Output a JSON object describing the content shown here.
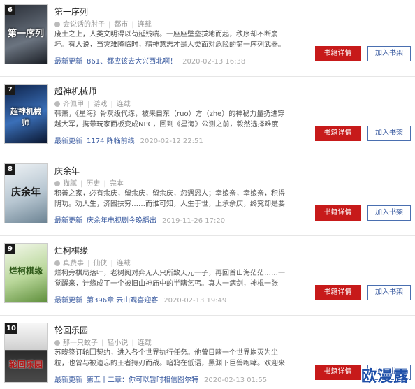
{
  "books": [
    {
      "rank": "6",
      "title": "第一序列",
      "author": "会说话的肘子",
      "category": "都市",
      "status": "连载",
      "desc": "废土之上，人类文明得以苟延残喘。一座座壁垒拔地而起，秩序却不断崩坏。有人说，当灾难降临时，精神意志才是人类面对危险的第一序列武器。有人说，不要让",
      "latest_label": "最新更新",
      "latest_chapter": "861、都应该去大兴西北啊！",
      "updated": "2020-02-13 16:38",
      "cover_text": "第一序列",
      "cover_colors": [
        "#2a2f38",
        "#6b7480"
      ]
    },
    {
      "rank": "7",
      "title": "超神机械师",
      "author": "齐佩甲",
      "category": "游戏",
      "status": "连载",
      "desc": "韩萧，《星海》骨灰级代练，被来自东（ruo）方（zhe）的神秘力量扔进穿越大军，携带玩家面板变成NPC，回到《星海》公测之前，毅然选择难度最高的机械系。战",
      "latest_label": "最新更新",
      "latest_chapter": "1174 降临前线",
      "updated": "2020-02-12 22:51",
      "cover_text": "超神机械师",
      "cover_colors": [
        "#0d2148",
        "#3a6fb8"
      ]
    },
    {
      "rank": "8",
      "title": "庆余年",
      "author": "猫腻",
      "category": "历史",
      "status": "完本",
      "desc": "积善之家，必有余庆，留余庆，留余庆，忽遇恩人；幸娘亲，幸娘亲，积得阴功。劝人生，济困扶穷……而谁可知，人生于世，上承余庆，终究却是要自己做出道路",
      "latest_label": "最新更新",
      "latest_chapter": "庆余年电视剧今晚播出",
      "updated": "2019-11-26 17:20",
      "cover_text": "庆余年",
      "cover_colors": [
        "#d8e0e6",
        "#8fa4b2"
      ]
    },
    {
      "rank": "9",
      "title": "烂柯棋缘",
      "author": "真费事",
      "category": "仙侠",
      "status": "连载",
      "desc": "烂柯旁棋局落叶，老树阅对弈无人只所致天元一子，再回首山海茫茫……一觉醒来，计缘成了一个被旧山神庙中的半瞎乞丐。真人一病剑，神棍一张嘴，就是计缘",
      "latest_label": "最新更新",
      "latest_chapter": "第396章 云山观喜迎客",
      "updated": "2020-02-13 19:49",
      "cover_text": "烂柯棋缘",
      "cover_colors": [
        "#e8f2d8",
        "#7fae55"
      ]
    },
    {
      "rank": "10",
      "title": "轮回乐园",
      "author": "那一只蚊子",
      "category": "轻小说",
      "status": "连载",
      "desc": "苏晓签订轮回契约，进入各个世界执行任务。他曾目睹一个世界崩灭为尘粒，也曾与被遗忘的王者持刃而战。暗鸦在低语，黑渊下巨兽咆哮。欢迎来到，轮回乐",
      "latest_label": "最新更新",
      "latest_chapter": "第五十二章：你可以暂时相信图尔特",
      "updated": "2020-02-13 01:55",
      "cover_text": "轮回乐园",
      "cover_colors": [
        "#f1f1f1",
        "#b5b5b5"
      ]
    }
  ],
  "buttons": {
    "detail": "书籍详情",
    "add": "加入书架"
  },
  "watermark": "欧漫露"
}
